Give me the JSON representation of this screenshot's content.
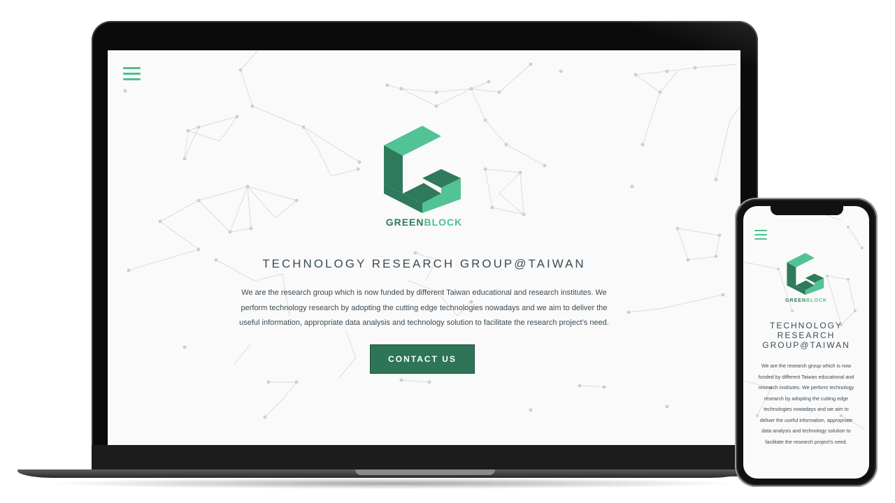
{
  "site": {
    "brand_part1": "GREEN",
    "brand_part2": "BLOCK",
    "headline": "TECHNOLOGY RESEARCH GROUP@TAIWAN",
    "description": "We are the research group which is now funded by different Taiwan educational and research institutes. We perform technology research by adopting the cutting edge technologies nowadays and we aim to deliver the useful information, appropriate data analysis and technology solution to facilitate the research project’s need.",
    "cta_label": "CONTACT US",
    "menu_icon": "hamburger-menu-icon",
    "logo_icon": "greenblock-g-cube-logo"
  },
  "colors": {
    "brand_dark": "#2f7a5c",
    "brand_light": "#4fbf8e",
    "button_bg": "#2e7558",
    "text": "#3b4a55"
  }
}
